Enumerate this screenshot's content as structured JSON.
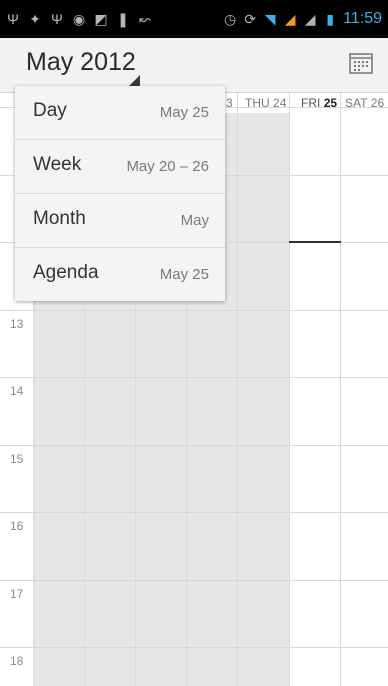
{
  "status_bar": {
    "icons": [
      "usb-icon",
      "android-debug-icon",
      "usb-icon",
      "record-icon",
      "no-sim-icon",
      "notification-icon",
      "missed-call-icon",
      "alarm-icon",
      "sync-icon",
      "wifi-icon",
      "signal-icon",
      "signal-weak-icon",
      "battery-icon"
    ],
    "time": "11:59"
  },
  "action_bar": {
    "title": "May 2012",
    "calendar_icon": "calendar-today-icon"
  },
  "week_header": {
    "days": [
      {
        "dow": "",
        "num": "3"
      },
      {
        "dow": "THU",
        "num": "24"
      },
      {
        "dow": "FRI",
        "num": "25"
      },
      {
        "dow": "SAT",
        "num": "26"
      }
    ]
  },
  "hours": [
    "13",
    "14",
    "15",
    "16",
    "17",
    "18"
  ],
  "view_menu": {
    "items": [
      {
        "label": "Day",
        "value": "May 25"
      },
      {
        "label": "Week",
        "value": "May 20 – 26"
      },
      {
        "label": "Month",
        "value": "May"
      },
      {
        "label": "Agenda",
        "value": "May 25"
      }
    ]
  }
}
